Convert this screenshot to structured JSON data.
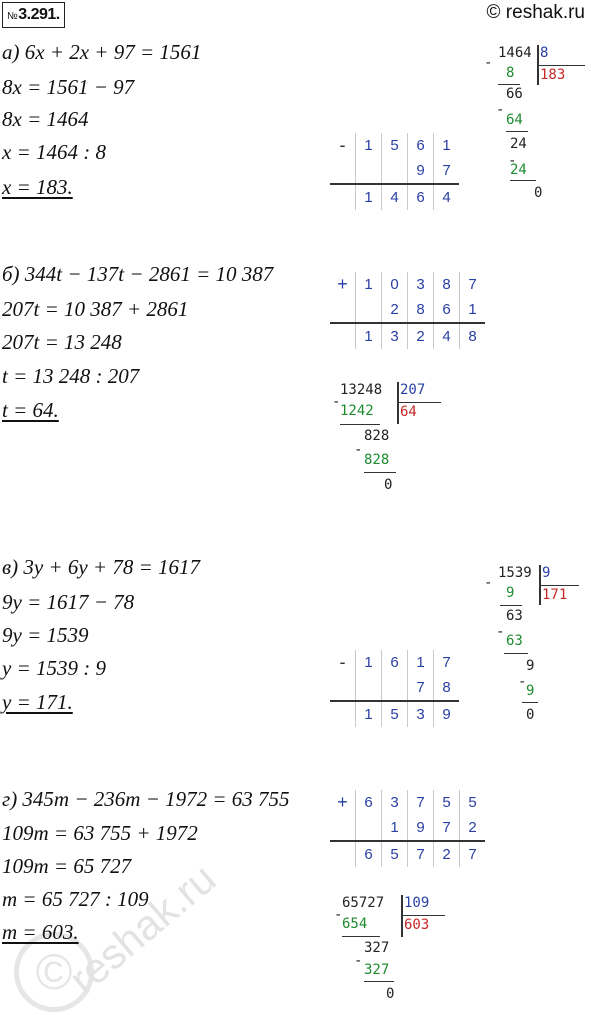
{
  "header": {
    "badge_prefix": "№",
    "badge_number": "3.291.",
    "site": "© reshak.ru"
  },
  "part_a": {
    "lines": [
      "а) 6x + 2x + 97 = 1561",
      "8x = 1561 − 97",
      "8x = 1464",
      "x = 1464 : 8",
      "x = 183."
    ],
    "table": {
      "op": "-",
      "rows": [
        [
          "1",
          "5",
          "6",
          "1"
        ],
        [
          "",
          "",
          "9",
          "7"
        ],
        [
          "1",
          "4",
          "6",
          "4"
        ]
      ]
    },
    "division": {
      "dividend": "1464",
      "divisor": "8",
      "quotient": "183",
      "steps": [
        "8",
        "66",
        "64",
        "24",
        "24",
        "0"
      ]
    }
  },
  "part_b": {
    "lines": [
      "б) 344t − 137t − 2861 = 10 387",
      "207t = 10 387 + 2861",
      "207t = 13 248",
      "t = 13 248 : 207",
      "t = 64."
    ],
    "table": {
      "op": "+",
      "rows": [
        [
          "1",
          "0",
          "3",
          "8",
          "7"
        ],
        [
          "",
          "2",
          "8",
          "6",
          "1"
        ],
        [
          "1",
          "3",
          "2",
          "4",
          "8"
        ]
      ]
    },
    "division": {
      "dividend": "13248",
      "divisor": "207",
      "quotient": "64",
      "steps": [
        "1242",
        "828",
        "828",
        "0"
      ]
    }
  },
  "part_v": {
    "lines": [
      "в) 3y + 6y + 78 = 1617",
      "9y = 1617 − 78",
      "9y = 1539",
      "y = 1539 : 9",
      "y = 171."
    ],
    "table": {
      "op": "-",
      "rows": [
        [
          "1",
          "6",
          "1",
          "7"
        ],
        [
          "",
          "",
          "7",
          "8"
        ],
        [
          "1",
          "5",
          "3",
          "9"
        ]
      ]
    },
    "division": {
      "dividend": "1539",
      "divisor": "9",
      "quotient": "171",
      "steps": [
        "9",
        "63",
        "63",
        "9",
        "9",
        "0"
      ]
    }
  },
  "part_g": {
    "lines": [
      "г) 345m − 236m − 1972 = 63 755",
      "109m = 63 755 + 1972",
      "109m = 65 727",
      "m = 65 727 : 109",
      "m = 603."
    ],
    "table": {
      "op": "+",
      "rows": [
        [
          "6",
          "3",
          "7",
          "5",
          "5"
        ],
        [
          "",
          "1",
          "9",
          "7",
          "2"
        ],
        [
          "6",
          "5",
          "7",
          "2",
          "7"
        ]
      ]
    },
    "division": {
      "dividend": "65727",
      "divisor": "109",
      "quotient": "603",
      "steps": [
        "654",
        "327",
        "327",
        "0"
      ]
    }
  },
  "watermark": {
    "text": "reshak.ru",
    "symbol": "©"
  }
}
